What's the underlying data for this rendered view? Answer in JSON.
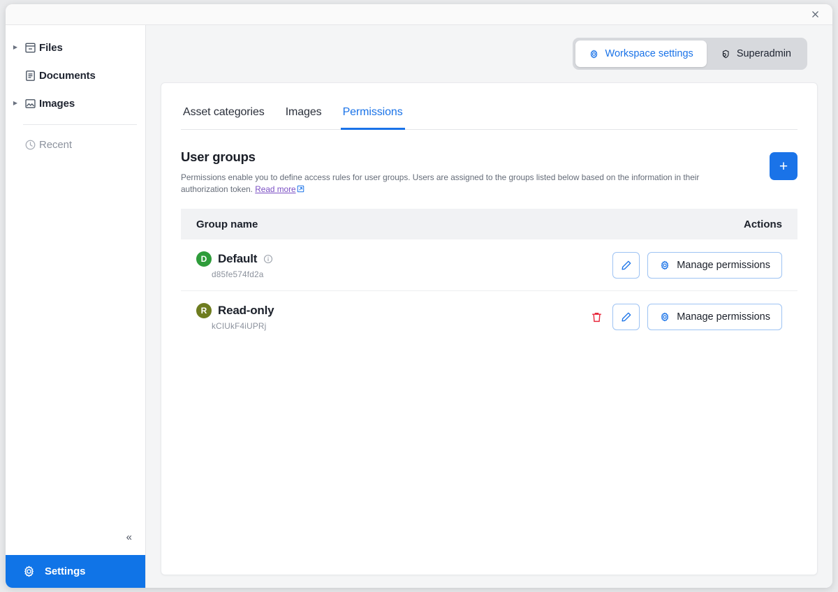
{
  "window": {
    "close_label": "×"
  },
  "sidebar": {
    "items": [
      {
        "label": "Files",
        "icon": "files-icon",
        "expandable": true,
        "muted": false
      },
      {
        "label": "Documents",
        "icon": "documents-icon",
        "expandable": false,
        "muted": false
      },
      {
        "label": "Images",
        "icon": "images-icon",
        "expandable": true,
        "muted": false
      },
      {
        "label": "Recent",
        "icon": "clock-icon",
        "expandable": false,
        "muted": true
      }
    ],
    "collapse_label": "«",
    "settings_label": "Settings",
    "settings_icon": "gear-icon",
    "settings_bg": "#1074e7"
  },
  "header": {
    "segmented": [
      {
        "label": "Workspace settings",
        "icon": "gear-icon",
        "active": true
      },
      {
        "label": "Superadmin",
        "icon": "shield-key-icon",
        "active": false
      }
    ]
  },
  "tabs": [
    {
      "label": "Asset categories",
      "active": false
    },
    {
      "label": "Images",
      "active": false
    },
    {
      "label": "Permissions",
      "active": true
    }
  ],
  "section": {
    "title": "User groups",
    "description": "Permissions enable you to define access rules for user groups. Users are assigned to the groups listed below based on the information in their authorization token.",
    "read_more_label": "Read more",
    "read_more_icon": "external-link-icon",
    "add_button_label": "+"
  },
  "table": {
    "columns": {
      "name": "Group name",
      "actions": "Actions"
    },
    "rows": [
      {
        "avatar_letter": "D",
        "avatar_color": "#2e9c3a",
        "name": "Default",
        "id": "d85fe574fd2a",
        "has_info": true,
        "has_delete": false,
        "edit_icon": "pencil-icon",
        "manage_label": "Manage permissions",
        "manage_icon": "gear-icon"
      },
      {
        "avatar_letter": "R",
        "avatar_color": "#6e7c1f",
        "name": "Read-only",
        "id": "kCIUkF4iUPRj",
        "has_info": false,
        "has_delete": true,
        "delete_icon": "trash-icon",
        "edit_icon": "pencil-icon",
        "manage_label": "Manage permissions",
        "manage_icon": "gear-icon"
      }
    ]
  },
  "colors": {
    "accent": "#1a73e8",
    "danger": "#e8283c",
    "link_visited": "#7b4fc4"
  }
}
